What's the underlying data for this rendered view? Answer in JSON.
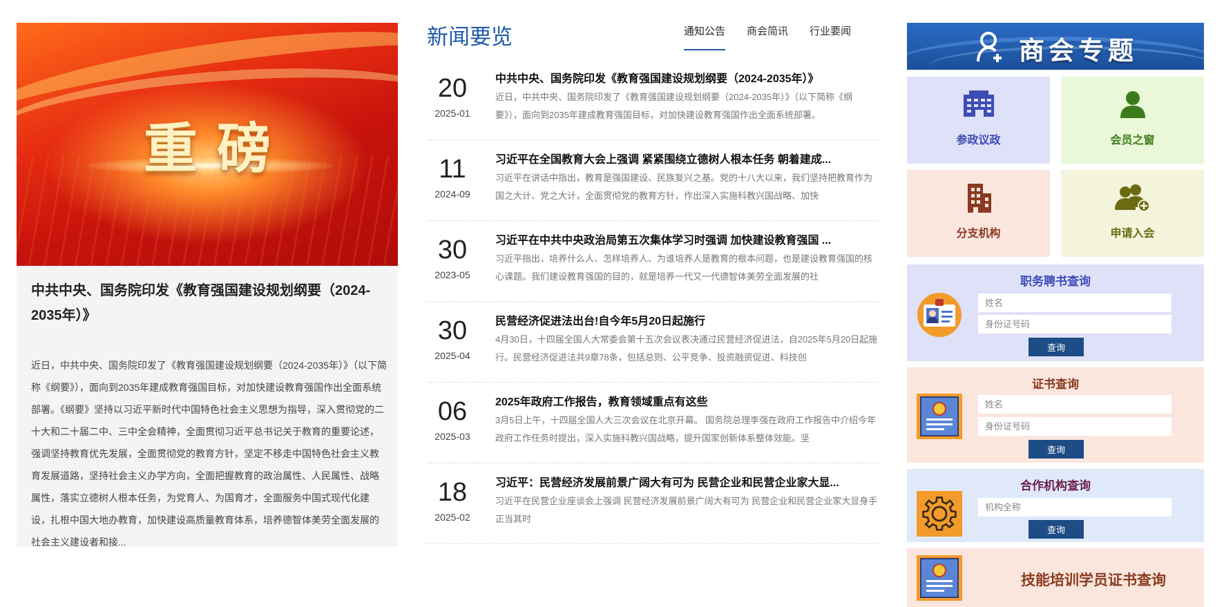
{
  "feature": {
    "banner_text": "重磅",
    "title": "中共中央、国务院印发《教育强国建设规划纲要（2024-2035年）》",
    "desc": "近日，中共中央、国务院印发了《教育强国建设规划纲要（2024-2035年）》（以下简称《纲要》），面向到2035年建成教育强国目标，对加快建设教育强国作出全面系统部署。《纲要》坚持以习近平新时代中国特色社会主义思想为指导，深入贯彻党的二十大和二十届二中、三中全会精神，全面贯彻习近平总书记关于教育的重要论述，强调坚持教育优先发展，全面贯彻党的教育方针，坚定不移走中国特色社会主义教育发展道路，坚持社会主义办学方向，全面把握教育的政治属性、人民属性、战略属性，落实立德树人根本任务，为党育人、为国育才，全面服务中国式现代化建设，扎根中国大地办教育，加快建设高质量教育体系，培养德智体美劳全面发展的社会主义建设者和接..."
  },
  "news": {
    "title": "新闻要览",
    "tabs": [
      "通知公告",
      "商会简讯",
      "行业要闻"
    ],
    "items": [
      {
        "day": "20",
        "ym": "2025-01",
        "headline": "中共中央、国务院印发《教育强国建设规划纲要（2024-2035年）》",
        "summary": "近日，中共中央、国务院印发了《教育强国建设规划纲要（2024-2035年）》（以下简称《纲要》），面向到2035年建成教育强国目标，对加快建设教育强国作出全面系统部署。"
      },
      {
        "day": "11",
        "ym": "2024-09",
        "headline": "习近平在全国教育大会上强调 紧紧围绕立德树人根本任务 朝着建成...",
        "summary": "习近平在讲话中指出，教育是强国建设、民族复兴之基。党的十八大以来，我们坚持把教育作为国之大计、党之大计，全面贯彻党的教育方针，作出深入实施科教兴国战略、加快"
      },
      {
        "day": "30",
        "ym": "2023-05",
        "headline": "习近平在中共中央政治局第五次集体学习时强调 加快建设教育强国 ...",
        "summary": "习近平指出，培养什么人、怎样培养人、为谁培养人是教育的根本问题，也是建设教育强国的核心课题。我们建设教育强国的目的，就是培养一代又一代德智体美劳全面发展的社"
      },
      {
        "day": "30",
        "ym": "2025-04",
        "headline": "民营经济促进法出台!自今年5月20日起施行",
        "summary": "4月30日，十四届全国人大常委会第十五次会议表决通过民营经济促进法，自2025年5月20日起施行。民营经济促进法共9章78条，包括总则、公平竞争、投资融资促进、科技创"
      },
      {
        "day": "06",
        "ym": "2025-03",
        "headline": "2025年政府工作报告，教育领域重点有这些",
        "summary": "3月5日上午，十四届全国人大三次会议在北京开幕。 国务院总理李强在政府工作报告中介绍今年政府工作任务时提出，深入实施科教兴国战略，提升国家创新体系整体效能。坚"
      },
      {
        "day": "18",
        "ym": "2025-02",
        "headline": "习近平：民营经济发展前景广阔大有可为 民营企业和民营企业家大显...",
        "summary": "习近平在民营企业座谈会上强调 民营经济发展前景广阔大有可为 民营企业和民营企业家大显身手正当其时"
      }
    ]
  },
  "special": {
    "title": "商会专题",
    "tiles": [
      {
        "label": "参政议政",
        "icon": "building-icon"
      },
      {
        "label": "会员之窗",
        "icon": "person-icon"
      },
      {
        "label": "分支机构",
        "icon": "office-icon"
      },
      {
        "label": "申请入会",
        "icon": "add-member-icon"
      }
    ]
  },
  "queries": {
    "appointment": {
      "title": "职务聘书查询",
      "name_placeholder": "姓名",
      "id_placeholder": "身份证号码",
      "button": "查询"
    },
    "certificate": {
      "title": "证书查询",
      "name_placeholder": "姓名",
      "id_placeholder": "身份证号码",
      "button": "查询"
    },
    "partner": {
      "title": "合作机构查询",
      "org_placeholder": "机构全称",
      "button": "查询"
    },
    "training": {
      "title": "技能培训学员证书查询"
    }
  },
  "colors": {
    "accent": "#1f5aa8",
    "button": "#1d4c86"
  }
}
